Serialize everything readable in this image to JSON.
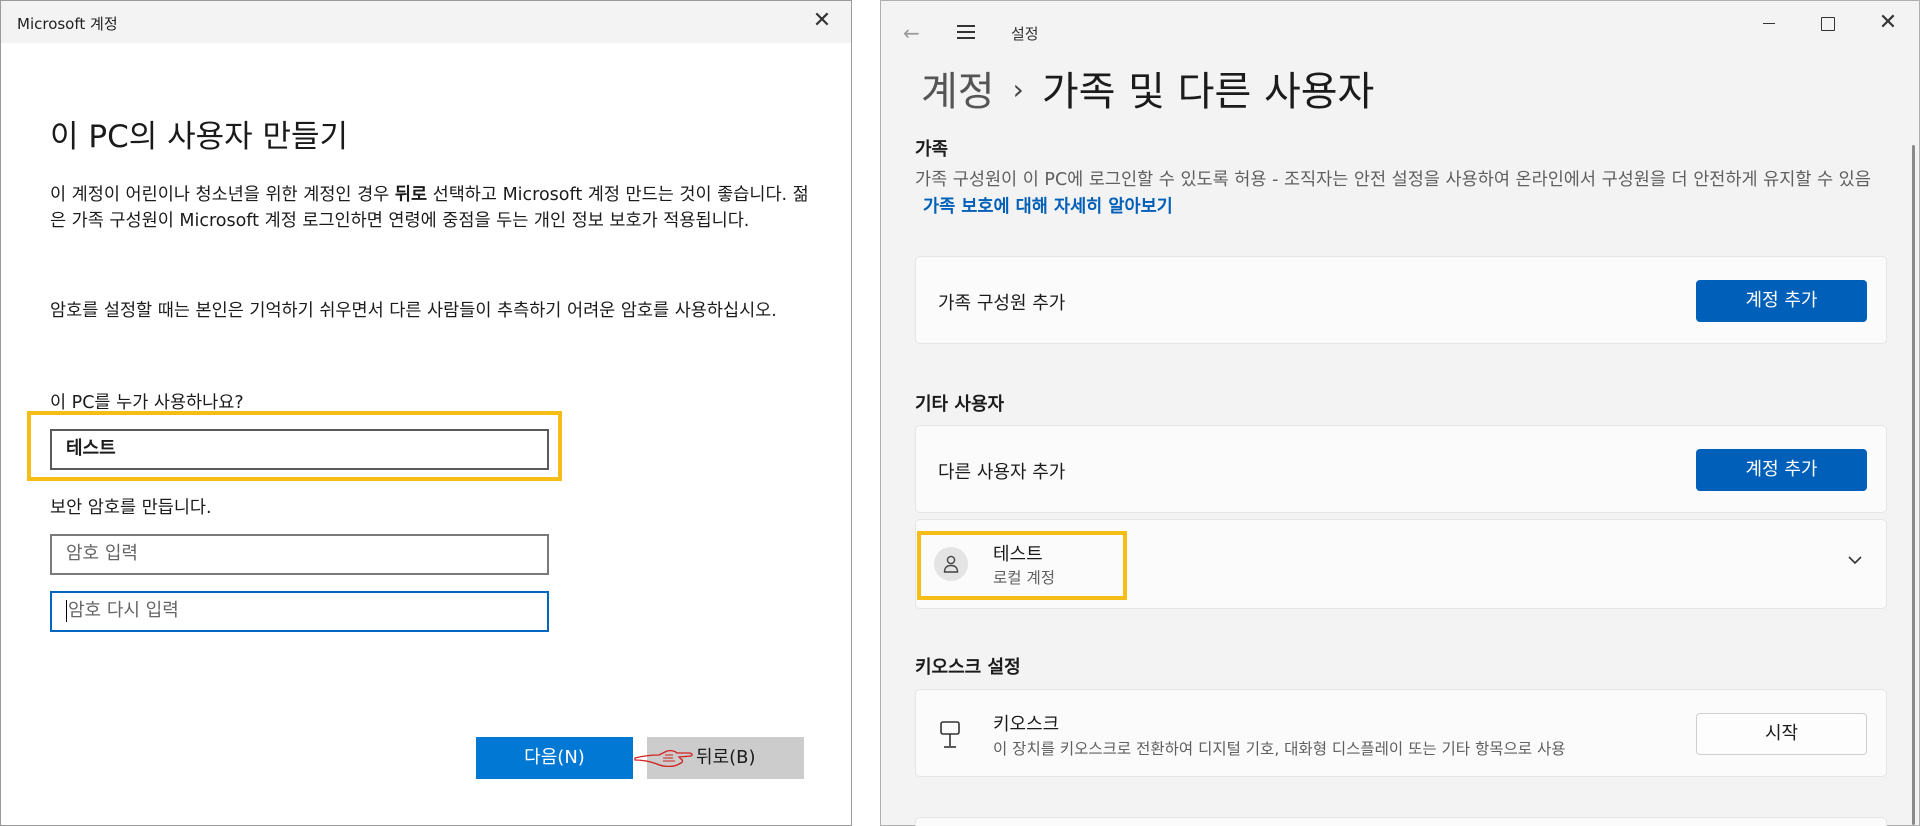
{
  "dialog": {
    "title": "Microsoft 계정",
    "heading": "이 PC의 사용자 만들기",
    "para1_a": "이 계정이 어린이나 청소년을 위한 계정인 경우 ",
    "para1_bold": "뒤로",
    "para1_b": " 선택하고 Microsoft 계정 만드는 것이 좋습니다. 젊은 가족 구성원이 Microsoft 계정 로그인하면 연령에 중점을 두는 개인 정보 보호가 적용됩니다.",
    "para2": "암호를 설정할 때는 본인은 기억하기 쉬우면서 다른 사람들이 추측하기 어려운 암호를 사용하십시오.",
    "user_label": "이 PC를 누가 사용하나요?",
    "user_value": "테스트",
    "password_label": "보안 암호를 만듭니다.",
    "password_placeholder": "암호 입력",
    "password_confirm_placeholder": "암호 다시 입력",
    "next_button": "다음(N)",
    "back_button": "뒤로(B)"
  },
  "settings": {
    "app_title": "설정",
    "breadcrumb_parent": "계정",
    "breadcrumb_current": "가족 및 다른 사용자",
    "family": {
      "title": "가족",
      "description": "가족 구성원이 이 PC에 로그인할 수 있도록 허용 - 조직자는 안전 설정을 사용하여 온라인에서 구성원을 더 안전하게 유지할 수 있음",
      "link": "가족 보호에 대해 자세히 알아보기",
      "add_label": "가족 구성원 추가",
      "add_button": "계정 추가"
    },
    "others": {
      "title": "기타 사용자",
      "add_label": "다른 사용자 추가",
      "add_button": "계정 추가",
      "user_name": "테스트",
      "user_type": "로컬 계정"
    },
    "kiosk": {
      "title": "키오스크 설정",
      "name": "키오스크",
      "description": "이 장치를 키오스크로 전환하여 디지털 기호, 대화형 디스플레이 또는 기타 항목으로 사용",
      "button": "시작"
    }
  },
  "colors": {
    "accent": "#0078d4",
    "settings_accent": "#005fb8",
    "highlight": "#f6bd16",
    "back_button_bg": "#cccccc"
  },
  "icons": [
    "close-icon",
    "back-arrow-icon",
    "hamburger-menu-icon",
    "minimize-icon",
    "maximize-icon",
    "person-icon",
    "chevron-down-icon",
    "kiosk-icon",
    "pointing-hand-icon"
  ]
}
